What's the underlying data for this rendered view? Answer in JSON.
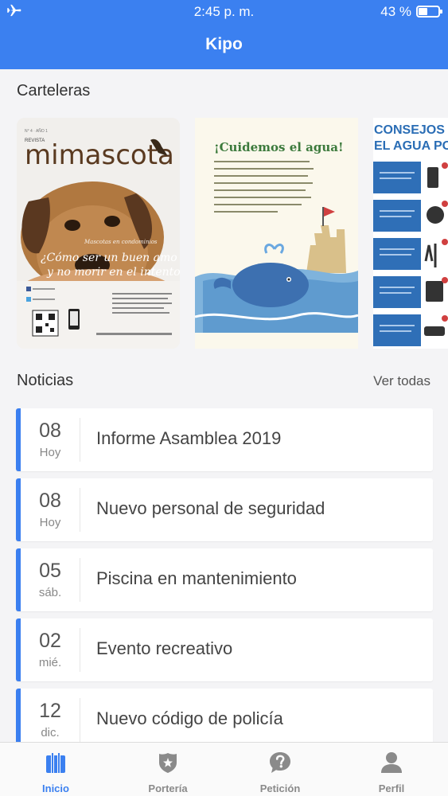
{
  "status_bar": {
    "time": "2:45 p. m.",
    "battery": "43 %"
  },
  "header": {
    "title": "Kipo"
  },
  "billboards": {
    "section_title": "Carteleras",
    "posters": [
      {
        "masthead": "REVISTA",
        "brand": "mimascota",
        "kicker": "Mascotas en condominios",
        "headline_1": "¿Cómo ser un buen amo",
        "headline_2": "y no morir en el intento?"
      },
      {
        "title": "¡Cuidemos el agua!"
      },
      {
        "title_1": "CONSEJOS PA",
        "title_2": "EL AGUA POT"
      }
    ]
  },
  "news": {
    "section_title": "Noticias",
    "view_all_label": "Ver todas",
    "items": [
      {
        "day": "08",
        "sub": "Hoy",
        "title": "Informe Asamblea 2019"
      },
      {
        "day": "08",
        "sub": "Hoy",
        "title": "Nuevo personal de seguridad"
      },
      {
        "day": "05",
        "sub": "sáb.",
        "title": "Piscina en mantenimiento"
      },
      {
        "day": "02",
        "sub": "mié.",
        "title": "Evento recreativo"
      },
      {
        "day": "12",
        "sub": "dic.",
        "title": "Nuevo código de policía"
      }
    ]
  },
  "tabbar": {
    "tabs": [
      {
        "label": "Inicio",
        "icon": "building-icon",
        "active": true
      },
      {
        "label": "Portería",
        "icon": "badge-icon",
        "active": false
      },
      {
        "label": "Petición",
        "icon": "question-bubble-icon",
        "active": false
      },
      {
        "label": "Perfil",
        "icon": "person-icon",
        "active": false
      }
    ]
  },
  "colors": {
    "accent": "#3b80f0",
    "news_border": "#3b7ff0",
    "background": "#f4f4f6"
  }
}
